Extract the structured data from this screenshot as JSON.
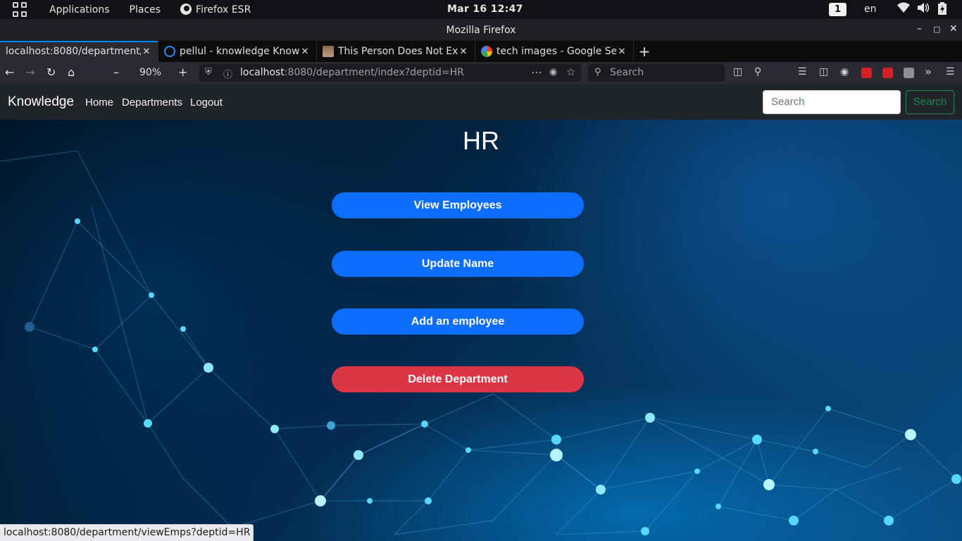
{
  "system_panel": {
    "applications": "Applications",
    "places": "Places",
    "active_app": "Firefox ESR",
    "clock": "Mar 16  12:47",
    "workspace": "1",
    "language": "en"
  },
  "window": {
    "title": "Mozilla Firefox"
  },
  "tabs": [
    {
      "label": "localhost:8080/department/",
      "active": true,
      "icon": "page-icon"
    },
    {
      "label": "pellul - knowledge Know",
      "active": false,
      "icon": "knowledge-favicon"
    },
    {
      "label": "This Person Does Not Exi",
      "active": false,
      "icon": "person-favicon"
    },
    {
      "label": "tech images - Google Sea",
      "active": false,
      "icon": "google-favicon"
    }
  ],
  "navbar": {
    "zoom": "90%",
    "url_host": "localhost",
    "url_rest": ":8080/department/index?deptid=HR",
    "search_placeholder": "Search"
  },
  "app": {
    "brand": "Knowledge",
    "nav_links": [
      "Home",
      "Departments",
      "Logout"
    ],
    "search_placeholder": "Search",
    "search_button": "Search",
    "department_title": "HR",
    "actions": [
      {
        "label": "View Employees",
        "style": "primary"
      },
      {
        "label": "Update Name",
        "style": "primary"
      },
      {
        "label": "Add an employee",
        "style": "primary"
      },
      {
        "label": "Delete Department",
        "style": "danger"
      }
    ]
  },
  "status_bar": {
    "link_preview": "localhost:8080/department/viewEmps?deptid=HR"
  },
  "colors": {
    "primary": "#0d6efd",
    "danger": "#dc3545",
    "success": "#198754",
    "app_nav": "#212529",
    "tab_accent": "#0a84ff"
  }
}
